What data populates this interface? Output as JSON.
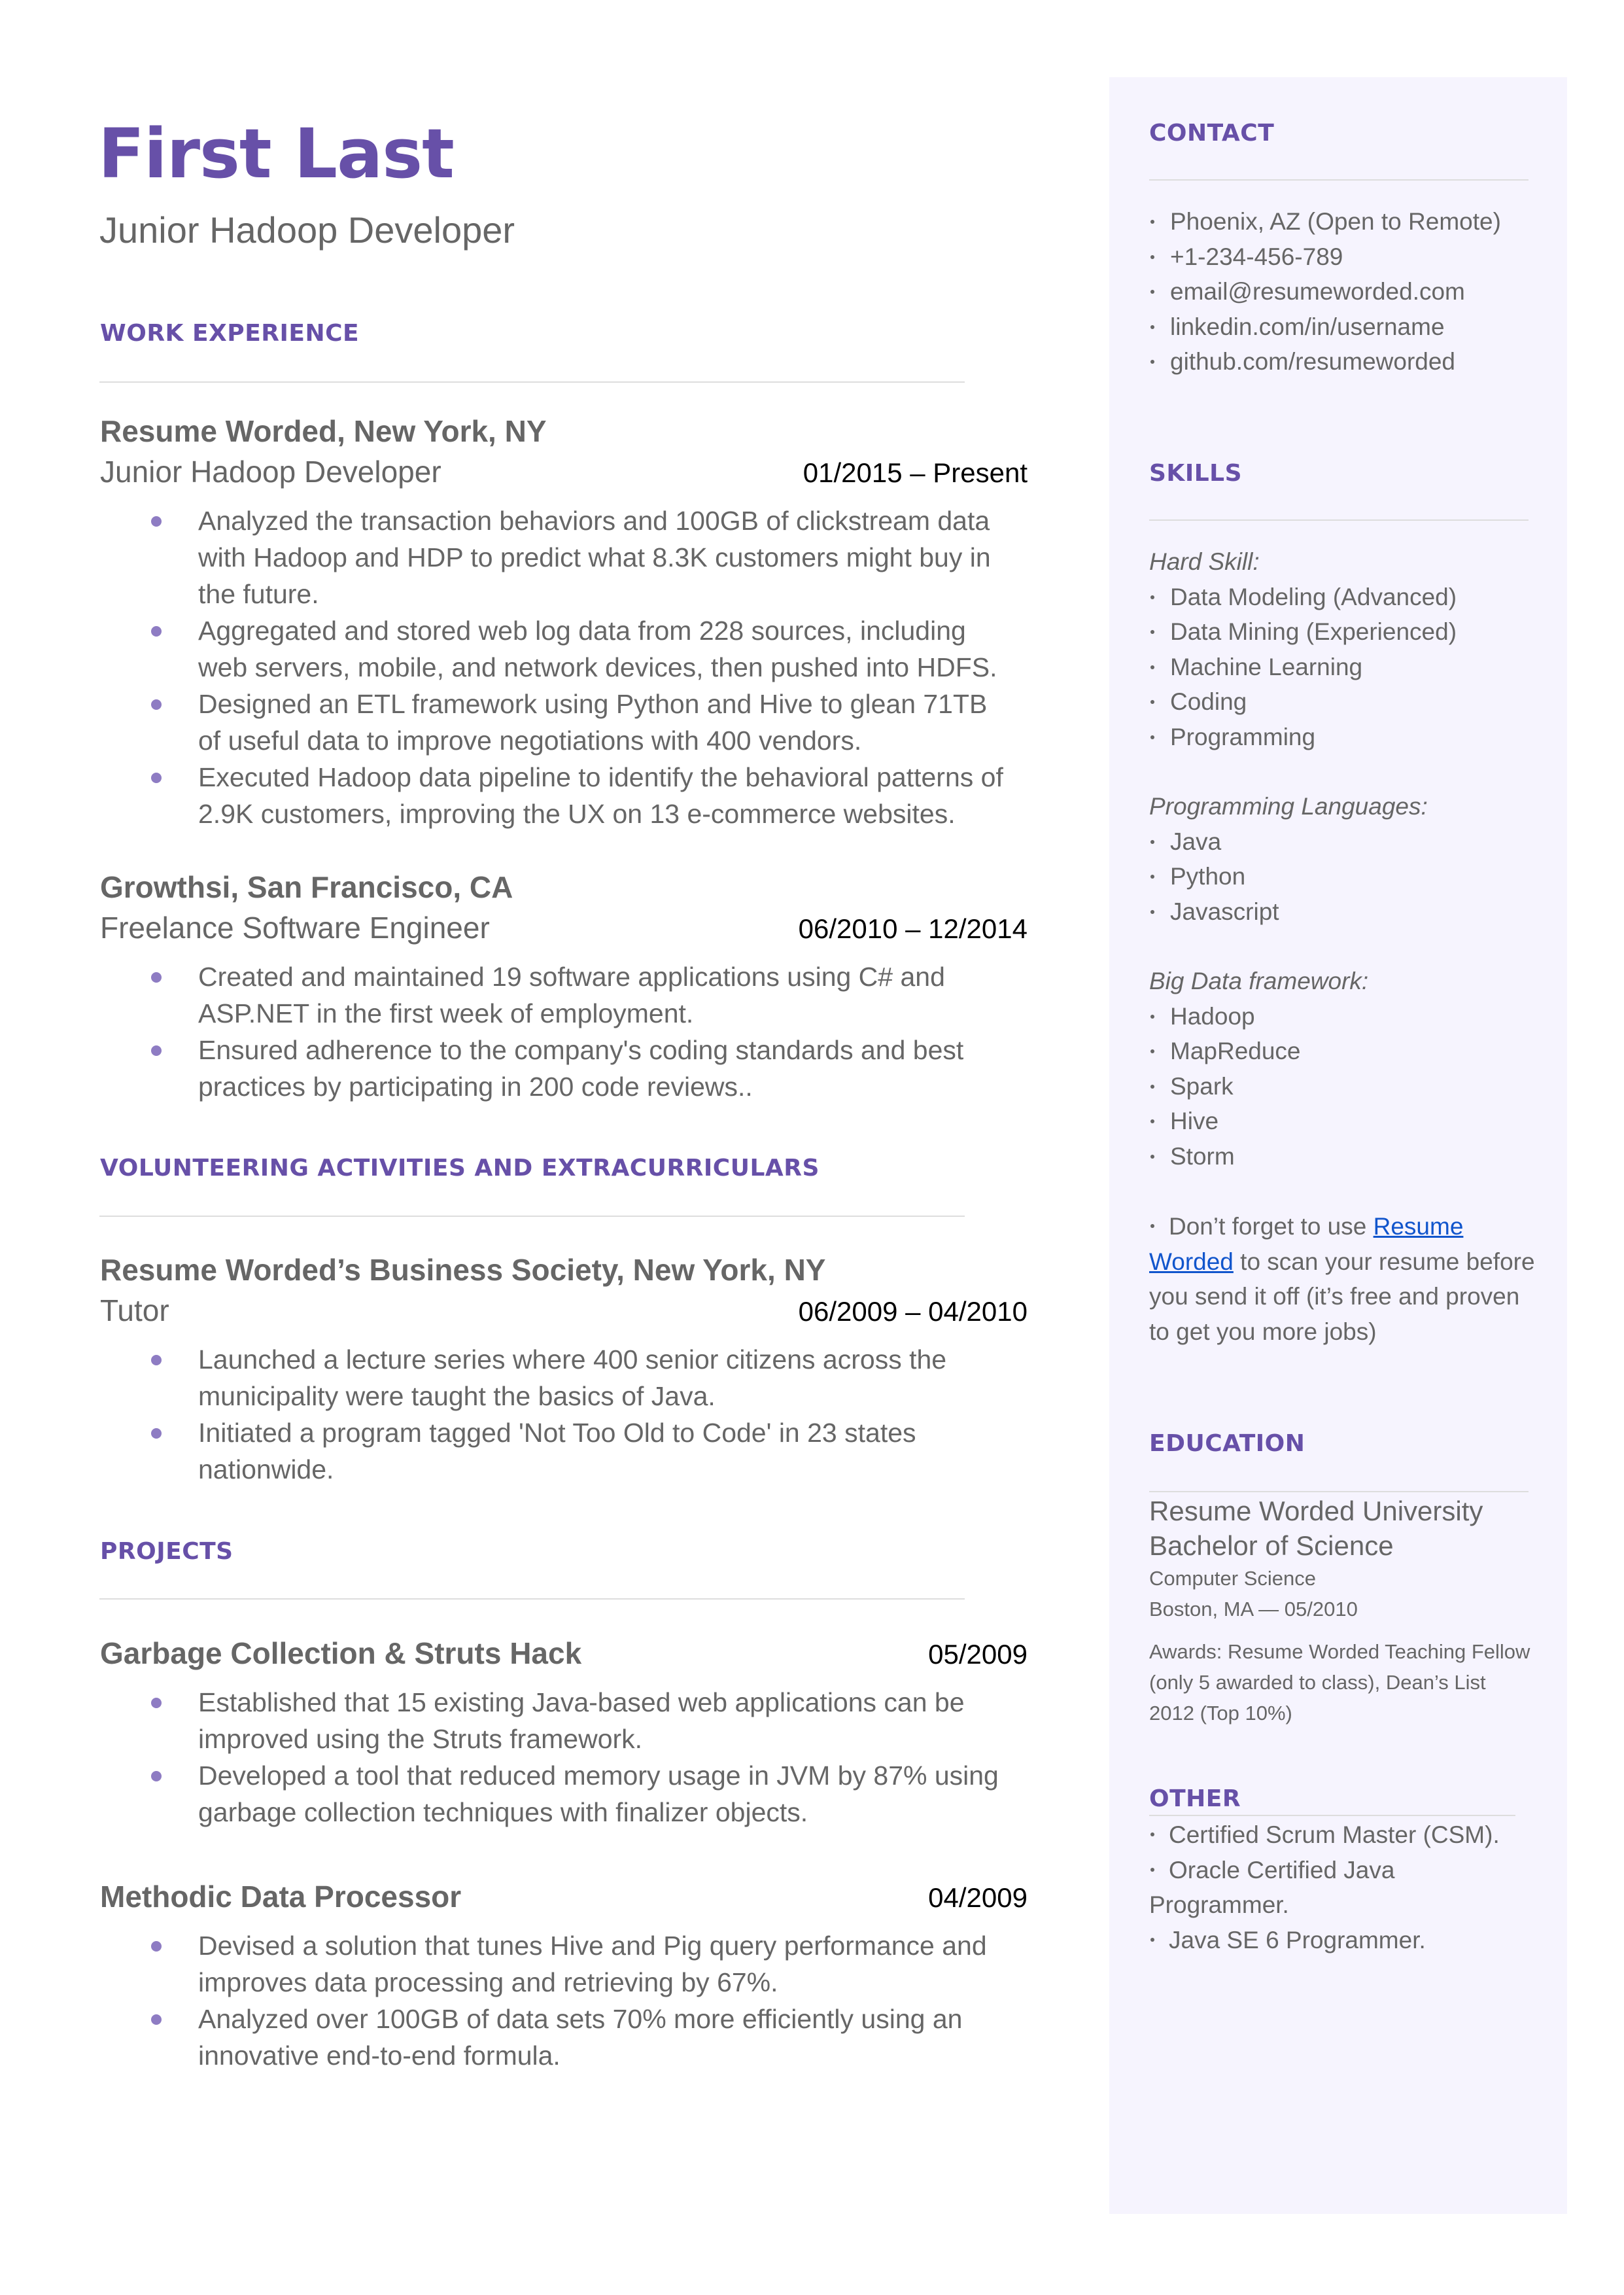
{
  "header": {
    "name": "First Last",
    "title": "Junior Hadoop Developer"
  },
  "colors": {
    "accent": "#6750a8",
    "bullet": "#8e7cc3",
    "sidebar_bg": "#f6f4fe",
    "link": "#1155cc",
    "text": "#666666"
  },
  "sections": {
    "work": "WORK EXPERIENCE",
    "volunteering": "VOLUNTEERING ACTIVITIES AND EXTRACURRICULARS",
    "projects": "PROJECTS"
  },
  "work": [
    {
      "company": "Resume Worded, New York, NY",
      "role": "Junior Hadoop Developer",
      "dates": "01/2015 – Present",
      "bullets": [
        "Analyzed the transaction behaviors and 100GB of clickstream data with Hadoop and HDP to predict what 8.3K customers might buy in the future.",
        "Aggregated and stored web log data from 228 sources, including web servers, mobile, and network devices, then pushed into HDFS.",
        "Designed an ETL framework using Python and Hive to glean 71TB of useful data to improve negotiations with 400 vendors.",
        "Executed Hadoop data pipeline to identify the behavioral patterns of 2.9K customers, improving the UX on 13 e-commerce websites."
      ]
    },
    {
      "company": "Growthsi, San Francisco, CA",
      "role": "Freelance Software Engineer",
      "dates": "06/2010 – 12/2014",
      "bullets": [
        "Created and maintained 19 software applications using C# and ASP.NET in the first week of employment.",
        "Ensured adherence to the company's coding standards and best practices by participating in 200 code reviews.."
      ]
    }
  ],
  "volunteering": [
    {
      "company": "Resume Worded’s Business Society, New York, NY",
      "role": "Tutor",
      "dates": "06/2009 – 04/2010",
      "bullets": [
        "Launched a lecture series where 400 senior citizens across the municipality were taught the basics of Java.",
        "Initiated a program tagged 'Not Too Old to Code' in 23 states nationwide."
      ]
    }
  ],
  "projects": [
    {
      "title": "Garbage Collection & Struts Hack",
      "date": "05/2009",
      "bullets": [
        "Established that 15 existing Java-based web applications can be improved using the Struts framework.",
        "Developed a tool that reduced memory usage in JVM by 87% using garbage collection techniques with finalizer objects."
      ]
    },
    {
      "title": "Methodic Data Processor",
      "date": "04/2009",
      "bullets": [
        "Devised a solution that tunes Hive and Pig query performance and improves data processing and retrieving by 67%.",
        "Analyzed over 100GB of data sets 70% more efficiently using an innovative end-to-end formula."
      ]
    }
  ],
  "sidebar": {
    "contact": {
      "heading": "CONTACT",
      "items": [
        "Phoenix, AZ (Open to Remote)",
        "+1-234-456-789",
        "email@resumeworded.com",
        "linkedin.com/in/username",
        "github.com/resumeworded"
      ]
    },
    "skills": {
      "heading": "SKILLS",
      "groups": [
        {
          "label": "Hard Skill:",
          "items": [
            "Data Modeling (Advanced)",
            "Data Mining (Experienced)",
            "Machine Learning",
            "Coding",
            "Programming"
          ]
        },
        {
          "label": "Programming Languages:",
          "items": [
            "Java",
            "Python",
            "Javascript"
          ]
        },
        {
          "label": "Big Data framework:",
          "items": [
            "Hadoop",
            "MapReduce",
            "Spark",
            "Hive",
            "Storm"
          ]
        }
      ],
      "note": {
        "before": "Don’t forget to use ",
        "link": "Resume Worded",
        "after": " to scan your resume before you send it off (it’s free and proven to get you more jobs)"
      }
    },
    "education": {
      "heading": "EDUCATION",
      "school": "Resume Worded University",
      "degree": "Bachelor of Science",
      "field": "Computer Science",
      "location_date": "Boston, MA — 05/2010",
      "awards": "Awards: Resume Worded Teaching Fellow (only 5 awarded to class), Dean’s List 2012 (Top 10%)"
    },
    "other": {
      "heading": "OTHER",
      "items": [
        "Certified Scrum Master (CSM).",
        "Oracle Certified Java Programmer.",
        "Java SE 6 Programmer."
      ]
    }
  }
}
